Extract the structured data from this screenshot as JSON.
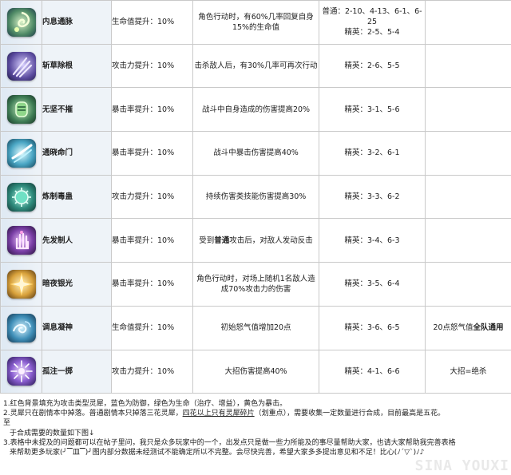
{
  "rows": [
    {
      "name": "内息通脉",
      "stat": "生命值提升：10%",
      "desc": "角色行动时，有60%几率回复自身15%的生命值",
      "stage1": "普通：2-10、4-13、6-1、6-25",
      "stage2": "精英：2-5、5-4",
      "note": "",
      "icon": "swirl-green-icon"
    },
    {
      "name": "斩草除根",
      "stat": "攻击力提升：10%",
      "desc": "击杀敌人后，有30%几率可再次行动",
      "stage1": "精英：2-6、5-5",
      "stage2": "",
      "note": "",
      "icon": "claw-purple-icon"
    },
    {
      "name": "无坚不摧",
      "stat": "暴击率提升：10%",
      "desc": "战斗中自身造成的伤害提高20%",
      "stage1": "精英：3-1、5-6",
      "stage2": "",
      "note": "",
      "icon": "gauntlet-green-icon"
    },
    {
      "name": "通晓命门",
      "stat": "暴击率提升：10%",
      "desc": "战斗中暴击伤害提高40%",
      "stage1": "精英：3-2、6-1",
      "stage2": "",
      "note": "",
      "icon": "slash-cyan-icon"
    },
    {
      "name": "炼制毒蛊",
      "stat": "攻击力提升：10%",
      "desc": "持续伤害类技能伤害提高30%",
      "stage1": "精英：3-3、6-2",
      "stage2": "",
      "note": "",
      "icon": "poison-teal-icon"
    },
    {
      "name": "先发制人",
      "stat": "暴击率提升：10%",
      "desc_pre": "受到",
      "desc_bold": "普通",
      "desc_post": "攻击后，对敌人发动反击",
      "stage1": "精英：3-4、6-3",
      "stage2": "",
      "note": "",
      "icon": "hand-purple-icon"
    },
    {
      "name": "暗夜银光",
      "stat": "暴击率提升：10%",
      "desc": "角色行动时，对场上随机1名敌人造成70%攻击力的伤害",
      "stage1": "精英：3-5、6-4",
      "stage2": "",
      "note": "",
      "icon": "star-gold-icon"
    },
    {
      "name": "调息凝神",
      "stat": "生命值提升：10%",
      "desc": "初始怒气值增加20点",
      "stage1": "精英：3-6、6-5",
      "stage2": "",
      "note_pre": "20点怒气值",
      "note_bold": "全队通用",
      "icon": "wave-blue-icon"
    },
    {
      "name": "孤注一掷",
      "stat": "攻击力提升：10%",
      "desc": "大招伤害提高40%",
      "stage1": "精英：4-1、6-6",
      "stage2": "",
      "note": "大招=绝杀",
      "icon": "burst-violet-icon"
    }
  ],
  "notes": {
    "n1": "1.红色背景填充为攻击类型灵犀，蓝色为防御，绿色为生命（治疗、增益），黄色为暴击。",
    "n2_pre": "2.灵犀只在剧情本中掉落。普通剧情本只掉落三花灵犀，",
    "n2_ul": "四花以上只有灵犀碎片",
    "n2_post": "（划重点），需要收集一定数量进行合成，目前最高是五花。",
    "n2_tail": "至",
    "n2b": "于合成需要的数量如下图↓",
    "n3": "3.表格中未提及的问题都可以在帖子里问，我只是众多玩家中的一个，出发点只是做一些力所能及的事尽量帮助大家，也请大家帮助我完善表格",
    "n4": "来帮助更多玩家(╯▔皿▔)╯图内部分数据未经测试不能确定所以不完整。会尽快完善，希望大家多多提出意见和不足！比心(ﾉ´▽`)ﾉ♪"
  },
  "watermark": "SINA YOUXI",
  "colors": {
    "icon_bg": "#dfe9f3",
    "name_bg": "#eef3f8",
    "border": "#c9c9c9"
  }
}
